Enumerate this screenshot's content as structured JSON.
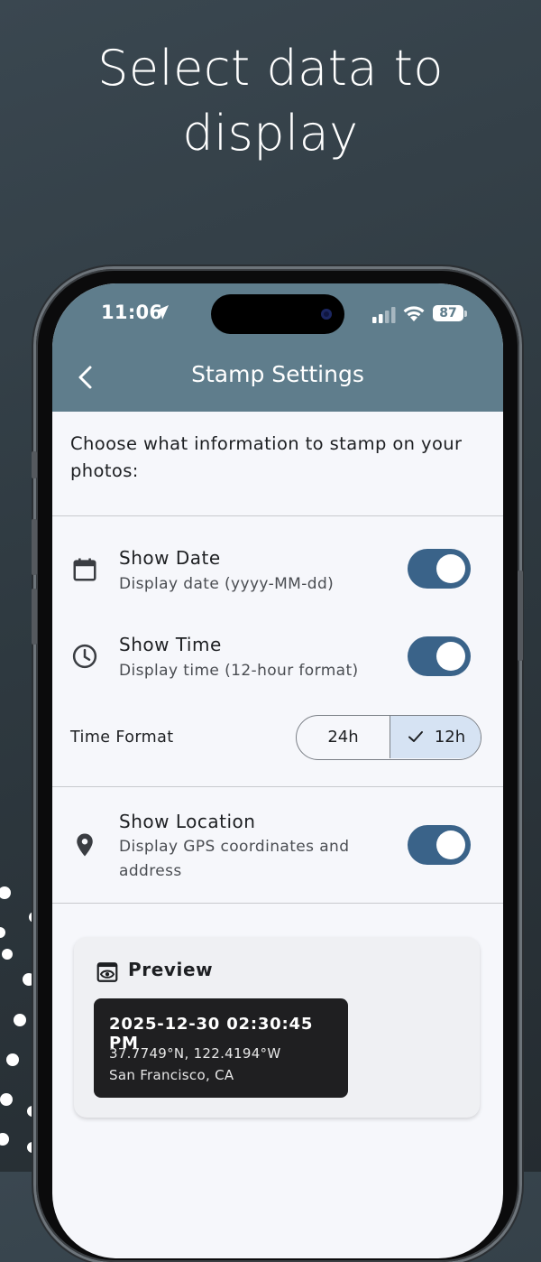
{
  "headline": {
    "line1": "Select data to",
    "line2": "display"
  },
  "status_bar": {
    "time": "11:06",
    "battery": "87"
  },
  "header": {
    "title": "Stamp Settings",
    "back_icon": "chevron-left-icon"
  },
  "intro": "Choose what information to stamp on your photos:",
  "settings": [
    {
      "id": "date",
      "icon": "calendar-icon",
      "title": "Show Date",
      "subtitle": "Display date (yyyy-MM-dd)",
      "enabled": true
    },
    {
      "id": "time",
      "icon": "clock-icon",
      "title": "Show Time",
      "subtitle": "Display time (12-hour format)",
      "enabled": true
    },
    {
      "id": "location",
      "icon": "location-pin-icon",
      "title": "Show Location",
      "subtitle": "Display GPS coordinates and address",
      "enabled": true
    }
  ],
  "time_format": {
    "label": "Time Format",
    "options": [
      "24h",
      "12h"
    ],
    "selected": "12h"
  },
  "preview": {
    "title": "Preview",
    "icon": "preview-eye-icon",
    "datetime": "2025-12-30 02:30:45 PM",
    "coordinates": "37.7749°N, 122.4194°W",
    "place": "San Francisco, CA"
  },
  "colors": {
    "appbar": "#5f7d8c",
    "toggle_on": "#3a6389",
    "segment_selected": "#d6e3f3",
    "stamp_bg": "#1f1f21"
  }
}
